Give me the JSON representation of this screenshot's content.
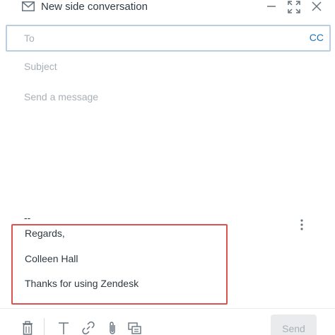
{
  "header": {
    "title": "New side conversation",
    "icons": [
      "mail-icon",
      "minimize-icon",
      "expand-icon",
      "close-icon"
    ]
  },
  "to_field": {
    "label": "To",
    "cc_label": "CC"
  },
  "subject": {
    "placeholder": "Subject"
  },
  "message": {
    "placeholder": "Send a message"
  },
  "signature": {
    "dashes": "--",
    "lines": [
      "Regards,",
      "Colleen Hall",
      "Thanks for using Zendesk"
    ]
  },
  "toolbar": {
    "icons": [
      "trash-icon",
      "text-format-icon",
      "link-icon",
      "attachment-icon",
      "macro-icon"
    ],
    "send_label": "Send"
  },
  "colors": {
    "accent": "#1f73b7",
    "focus_border": "#b9cde3",
    "highlight_border": "#d9534f",
    "placeholder": "#a9b0b6"
  }
}
